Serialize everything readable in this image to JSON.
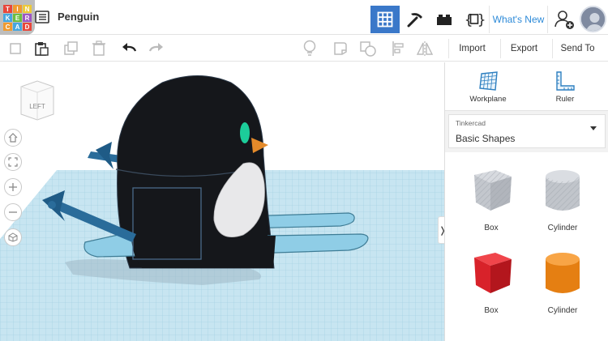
{
  "app": {
    "logo_letters": [
      "T",
      "I",
      "N",
      "K",
      "E",
      "R",
      "C",
      "A",
      "D"
    ],
    "logo_colors": [
      "#e8473b",
      "#f09a2e",
      "#ecc93a",
      "#45a7e0",
      "#6cbf3f",
      "#9e56c3",
      "#f09a2e",
      "#45a7e0",
      "#e8473b"
    ],
    "design_title": "Penguin"
  },
  "header": {
    "views": [
      {
        "icon": "3d-design-grid-icon",
        "active": true
      },
      {
        "icon": "pickaxe-icon",
        "active": false
      },
      {
        "icon": "bricks-icon",
        "active": false
      },
      {
        "icon": "codeblocks-icon",
        "active": false
      }
    ],
    "whats_new": "What's New",
    "user_icon": "add-user-icon",
    "avatar_icon": "user-avatar"
  },
  "toolbar": {
    "left_icons": [
      "copy-icon",
      "paste-icon",
      "duplicate-icon",
      "delete-icon",
      "undo-icon",
      "redo-icon"
    ],
    "right_icons": [
      "light-bulb-icon",
      "note-icon",
      "group-icon",
      "ungroup-icon",
      "align-icon",
      "mirror-icon"
    ],
    "import_label": "Import",
    "export_label": "Export",
    "send_to_label": "Send To"
  },
  "viewport": {
    "view_cube_label": "LEFT",
    "nav_buttons": [
      "home-icon",
      "fit-all-icon",
      "zoom-in-icon",
      "zoom-out-icon",
      "orthographic-icon"
    ]
  },
  "panel": {
    "workplane_label": "Workplane",
    "ruler_label": "Ruler",
    "library_source": "Tinkercad",
    "library_name": "Basic Shapes",
    "shapes": [
      {
        "label": "Box",
        "color": "#b8bcc4",
        "kind": "box-hole"
      },
      {
        "label": "Cylinder",
        "color": "#b8bcc4",
        "kind": "cylinder-hole"
      },
      {
        "label": "Box",
        "color": "#e0242c",
        "kind": "box"
      },
      {
        "label": "Cylinder",
        "color": "#f08a1c",
        "kind": "cylinder"
      }
    ]
  },
  "colors": {
    "accent": "#3a78c9",
    "whats_new": "#2d8ad8",
    "penguin_body": "#15171b",
    "skis": "#8fcde6",
    "ski_poles": "#2a6c9a",
    "beak": "#e48a2a",
    "eye": "#1ccd9a",
    "grid_floor": "#bfe0ee"
  }
}
